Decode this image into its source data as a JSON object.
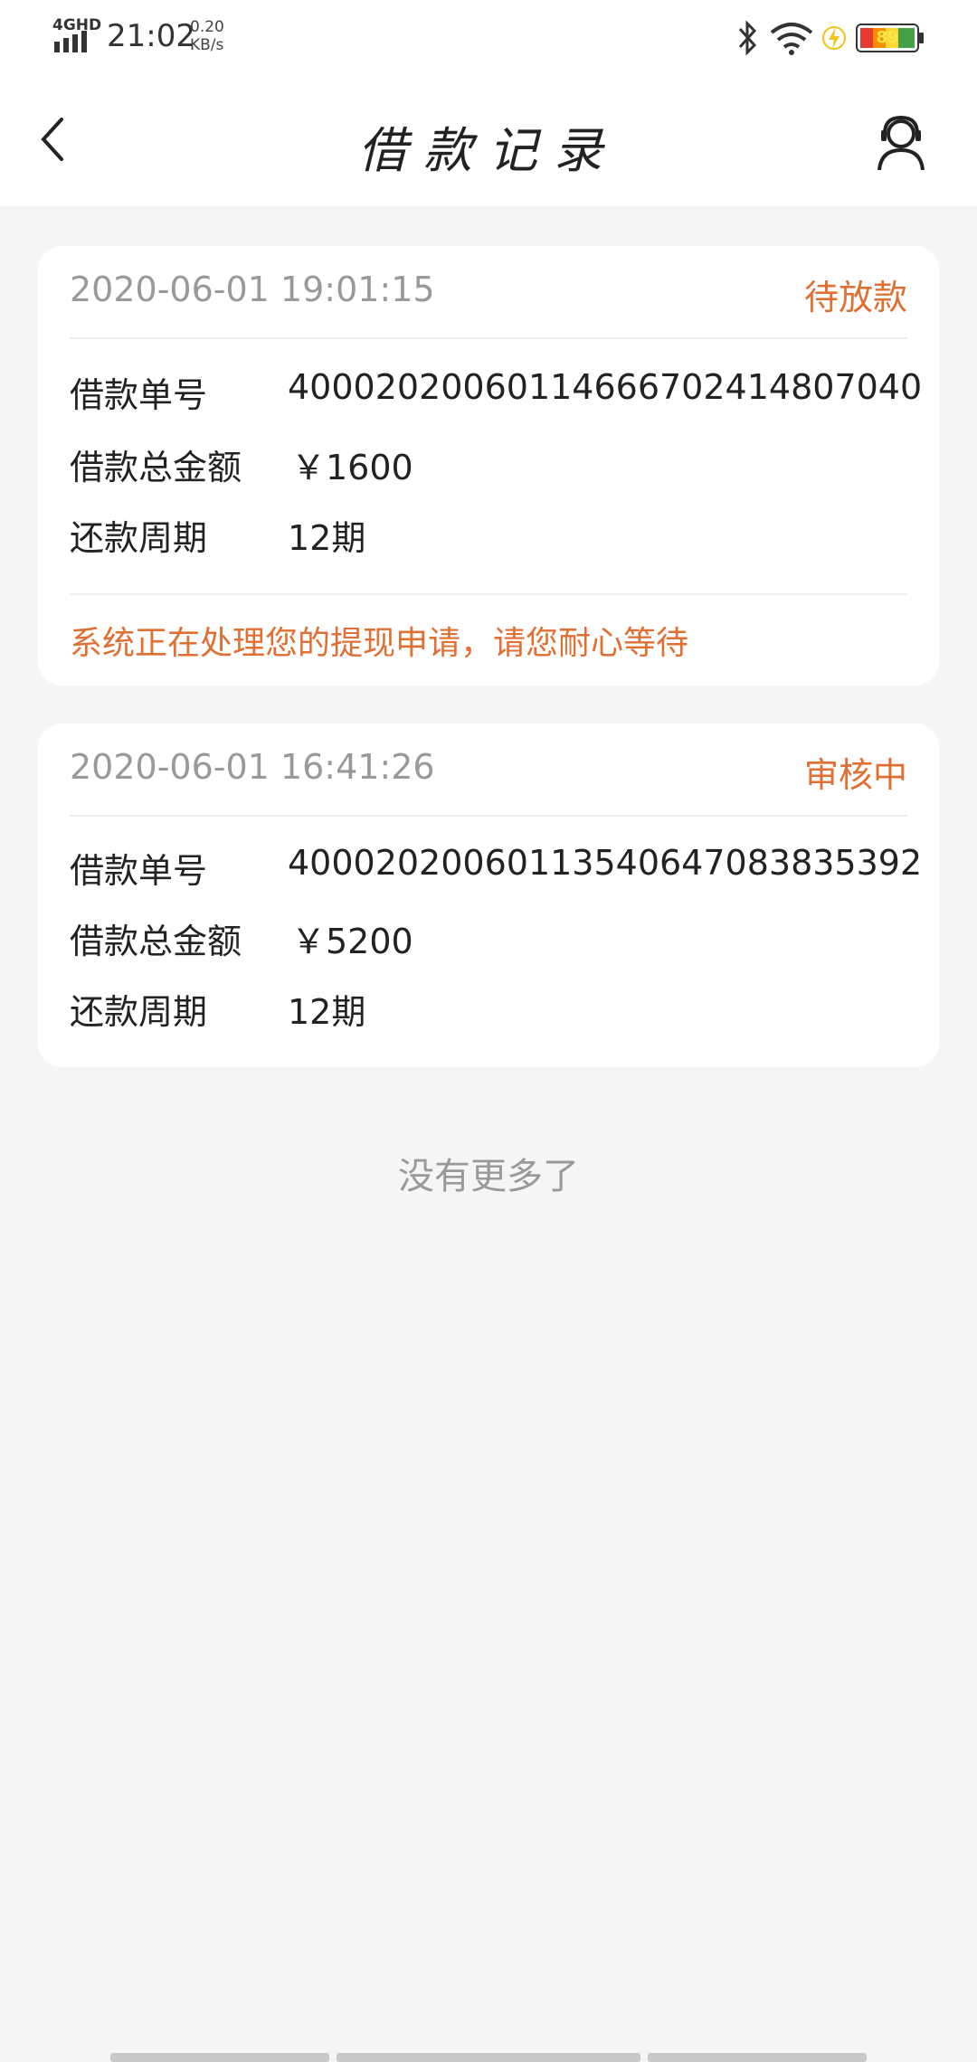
{
  "status_bar": {
    "network": "4GHD",
    "time": "21:02",
    "speed_value": "0.20",
    "speed_unit": "KB/s",
    "battery_level": "89",
    "icons": [
      "signal-icon",
      "bluetooth-icon",
      "wifi-icon",
      "charging-icon",
      "battery-icon"
    ]
  },
  "nav": {
    "title": "借款记录",
    "back_icon": "chevron-left-icon",
    "service_icon": "customer-service-icon"
  },
  "loans": [
    {
      "time": "2020-06-01 19:01:15",
      "status": "待放款",
      "order_label": "借款单号",
      "order_no": "4000202006011466670241480704​0",
      "amount_label": "借款总金额",
      "amount": "￥1600",
      "period_label": "还款周期",
      "period": "12期",
      "note": "系统正在处理您的提现申请，请您耐心等待"
    },
    {
      "time": "2020-06-01 16:41:26",
      "status": "审核中",
      "order_label": "借款单号",
      "order_no": "4000202006011354064708383539​2",
      "amount_label": "借款总金额",
      "amount": "￥5200",
      "period_label": "还款周期",
      "period": "12期"
    }
  ],
  "footer": {
    "no_more": "没有更多了"
  },
  "colors": {
    "accent": "#e06f33",
    "muted": "#999999",
    "background": "#f5f5f5",
    "card": "#ffffff"
  }
}
